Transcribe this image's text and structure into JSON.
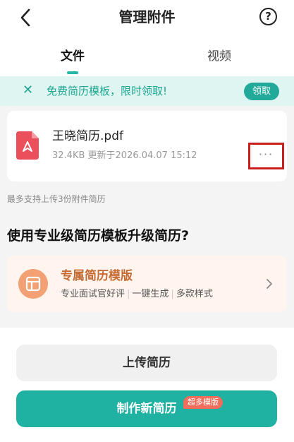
{
  "header": {
    "title": "管理附件",
    "back_icon": "chevron-left-icon",
    "help_label": "?"
  },
  "tabs": [
    {
      "label": "文件",
      "active": true
    },
    {
      "label": "视频",
      "active": false
    }
  ],
  "banner": {
    "close_label": "✕",
    "text": "免费简历模板，限时领取!",
    "button_label": "领取"
  },
  "file": {
    "name": "王晓简历.pdf",
    "meta": "32.4KB 更新于2026.04.07 15:12",
    "more_label": "···",
    "icon": "pdf-file-icon"
  },
  "limit_note": "最多支持上传3份附件简历",
  "promo": {
    "title": "使用专业级简历模板升级简历?"
  },
  "template_card": {
    "title": "专属简历模版",
    "features": [
      "专业面试官好评",
      "一键生成",
      "多款样式"
    ],
    "icon": "template-layout-icon"
  },
  "actions": {
    "upload_label": "上传简历",
    "create_label": "制作新简历",
    "create_badge": "超多模版"
  },
  "colors": {
    "accent": "#1fb1a2",
    "pdf_red": "#ec4f5c",
    "highlight_box": "#c9201f",
    "template_orange": "#c56a32"
  }
}
